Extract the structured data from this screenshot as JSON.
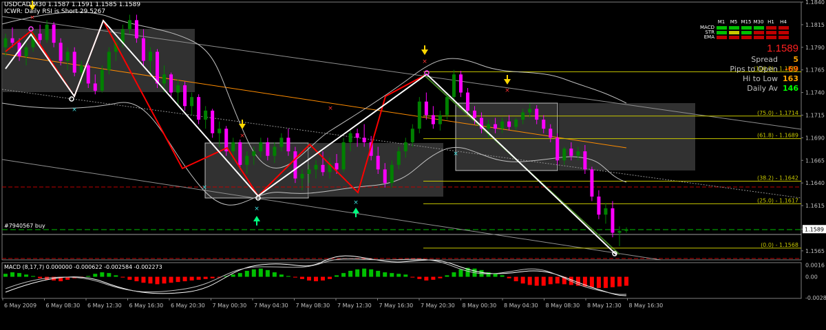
{
  "header": {
    "symbol_line": "USDCAD,M30  1.1587 1.1591 1.1585 1.1589",
    "indicator_line": "ICWR: Daily RSI is Short 29.5267"
  },
  "panel": {
    "timeframes": [
      "M1",
      "M5",
      "M15",
      "M30",
      "H1",
      "H4"
    ],
    "rows": [
      {
        "label": "MACD",
        "colors": [
          "#00c000",
          "#00c000",
          "#00c000",
          "#00c000",
          "#c00000",
          "#c00000"
        ]
      },
      {
        "label": "STR",
        "colors": [
          "#00c000",
          "#c8c800",
          "#00c000",
          "#c00000",
          "#c00000",
          "#c00000"
        ]
      },
      {
        "label": "EMA",
        "colors": [
          "#c00000",
          "#c00000",
          "#c00000",
          "#c00000",
          "#c00000",
          "#c00000"
        ]
      }
    ],
    "price": "1.1589",
    "price_color": "#ff2020",
    "stats": [
      {
        "label": "Spread",
        "value": "5",
        "color": "#ffa500"
      },
      {
        "label": "Pips to Open",
        "value": "-69",
        "color": "#ff6600"
      },
      {
        "label": "Hi to Low",
        "value": "163",
        "color": "#ffa500"
      },
      {
        "label": "Daily Av",
        "value": "146",
        "color": "#00ff00"
      }
    ]
  },
  "order_label": "#7940567 buy",
  "colors": {
    "bull": "#008000",
    "bear": "#ff00ff",
    "fib": "#c8c800",
    "zigzag_red": "#ff0000",
    "zigzag_white": "#ffffff",
    "macd_pos": "#00c000",
    "macd_neg": "#ff0000"
  },
  "chart_data": [
    {
      "type": "candlestick",
      "symbol": "USDCAD",
      "timeframe": "M30",
      "ylim": [
        1.1555,
        1.184
      ],
      "y_ticks": [
        "1.1840",
        "1.1815",
        "1.1790",
        "1.1765",
        "1.1740",
        "1.1715",
        "1.1690",
        "1.1665",
        "1.1640",
        "1.1615",
        "1.1589",
        "1.1565"
      ],
      "x_ticks": [
        "6 May 2009",
        "6 May 08:30",
        "6 May 12:30",
        "6 May 16:30",
        "6 May 20:30",
        "7 May 00:30",
        "7 May 04:30",
        "7 May 08:30",
        "7 May 12:30",
        "7 May 16:30",
        "7 May 20:30",
        "8 May 00:30",
        "8 May 04:30",
        "8 May 08:30",
        "8 May 12:30",
        "8 May 16:30"
      ],
      "last_price": "1.1589",
      "fib_levels": [
        {
          "label": "(100.0) - 1.1763",
          "value": 1.1763
        },
        {
          "label": "(75.0) - 1.1714",
          "value": 1.1714
        },
        {
          "label": "(61.8) - 1.1689",
          "value": 1.1689
        },
        {
          "label": "(38.2) - 1.1642",
          "value": 1.1642
        },
        {
          "label": "(25.0) - 1.1617",
          "value": 1.1617
        },
        {
          "label": "(0.0) - 1.1568",
          "value": 1.1568
        }
      ],
      "candles_ohlc": [
        [
          1.179,
          1.1805,
          1.178,
          1.18
        ],
        [
          1.18,
          1.1812,
          1.179,
          1.1795
        ],
        [
          1.1795,
          1.18,
          1.1775,
          1.178
        ],
        [
          1.178,
          1.1795,
          1.177,
          1.179
        ],
        [
          1.179,
          1.1808,
          1.1785,
          1.1805
        ],
        [
          1.1805,
          1.1815,
          1.179,
          1.1798
        ],
        [
          1.1798,
          1.182,
          1.1795,
          1.1815
        ],
        [
          1.1815,
          1.1818,
          1.179,
          1.1795
        ],
        [
          1.1795,
          1.18,
          1.177,
          1.1775
        ],
        [
          1.1775,
          1.179,
          1.1765,
          1.1785
        ],
        [
          1.1785,
          1.179,
          1.1758,
          1.1762
        ],
        [
          1.1762,
          1.1775,
          1.175,
          1.177
        ],
        [
          1.177,
          1.1772,
          1.1745,
          1.175
        ],
        [
          1.175,
          1.176,
          1.1738,
          1.1742
        ],
        [
          1.1742,
          1.177,
          1.174,
          1.1765
        ],
        [
          1.1765,
          1.179,
          1.176,
          1.1785
        ],
        [
          1.1785,
          1.18,
          1.1775,
          1.1795
        ],
        [
          1.1795,
          1.1815,
          1.179,
          1.181
        ],
        [
          1.181,
          1.1826,
          1.1805,
          1.182
        ],
        [
          1.182,
          1.1826,
          1.1795,
          1.18
        ],
        [
          1.18,
          1.181,
          1.177,
          1.1775
        ],
        [
          1.1775,
          1.179,
          1.176,
          1.1785
        ],
        [
          1.1785,
          1.1788,
          1.1745,
          1.175
        ],
        [
          1.175,
          1.177,
          1.174,
          1.176
        ],
        [
          1.176,
          1.1762,
          1.1735,
          1.174
        ],
        [
          1.174,
          1.1755,
          1.1725,
          1.1748
        ],
        [
          1.1748,
          1.1752,
          1.172,
          1.1725
        ],
        [
          1.1725,
          1.174,
          1.1715,
          1.1735
        ],
        [
          1.1735,
          1.1738,
          1.1705,
          1.171
        ],
        [
          1.171,
          1.1725,
          1.17,
          1.172
        ],
        [
          1.172,
          1.1722,
          1.169,
          1.1695
        ],
        [
          1.1695,
          1.1708,
          1.168,
          1.17
        ],
        [
          1.17,
          1.1703,
          1.167,
          1.1675
        ],
        [
          1.1675,
          1.169,
          1.1665,
          1.1685
        ],
        [
          1.1685,
          1.1688,
          1.1655,
          1.166
        ],
        [
          1.166,
          1.1675,
          1.165,
          1.167
        ],
        [
          1.167,
          1.168,
          1.166,
          1.1675
        ],
        [
          1.1675,
          1.169,
          1.1668,
          1.1685
        ],
        [
          1.1685,
          1.169,
          1.1665,
          1.167
        ],
        [
          1.167,
          1.1685,
          1.1662,
          1.168
        ],
        [
          1.168,
          1.1695,
          1.1675,
          1.169
        ],
        [
          1.169,
          1.17,
          1.167,
          1.1675
        ],
        [
          1.1675,
          1.168,
          1.164,
          1.1645
        ],
        [
          1.1645,
          1.1655,
          1.1632,
          1.165
        ],
        [
          1.165,
          1.166,
          1.164,
          1.1655
        ],
        [
          1.1655,
          1.1665,
          1.1645,
          1.166
        ],
        [
          1.166,
          1.1675,
          1.1648,
          1.1652
        ],
        [
          1.1652,
          1.1668,
          1.1645,
          1.1662
        ],
        [
          1.1662,
          1.1672,
          1.165,
          1.1655
        ],
        [
          1.1655,
          1.169,
          1.1652,
          1.1685
        ],
        [
          1.1685,
          1.1698,
          1.1675,
          1.1695
        ],
        [
          1.1695,
          1.17,
          1.168,
          1.169
        ],
        [
          1.169,
          1.1705,
          1.168,
          1.1685
        ],
        [
          1.1685,
          1.1692,
          1.1665,
          1.167
        ],
        [
          1.167,
          1.168,
          1.165,
          1.1655
        ],
        [
          1.1655,
          1.1662,
          1.1635,
          1.164
        ],
        [
          1.164,
          1.1665,
          1.1635,
          1.166
        ],
        [
          1.166,
          1.168,
          1.1655,
          1.1675
        ],
        [
          1.1675,
          1.169,
          1.1668,
          1.1685
        ],
        [
          1.1685,
          1.1705,
          1.168,
          1.17
        ],
        [
          1.17,
          1.1735,
          1.1695,
          1.173
        ],
        [
          1.173,
          1.174,
          1.171,
          1.1715
        ],
        [
          1.1715,
          1.1725,
          1.17,
          1.1705
        ],
        [
          1.1705,
          1.172,
          1.1698,
          1.1715
        ],
        [
          1.1715,
          1.174,
          1.171,
          1.1735
        ],
        [
          1.1735,
          1.1765,
          1.173,
          1.176
        ],
        [
          1.176,
          1.1764,
          1.1735,
          1.174
        ],
        [
          1.174,
          1.1745,
          1.1715,
          1.172
        ],
        [
          1.172,
          1.1725,
          1.1705,
          1.1712
        ],
        [
          1.1712,
          1.1718,
          1.1695,
          1.17
        ],
        [
          1.17,
          1.171,
          1.169,
          1.1705
        ],
        [
          1.1705,
          1.1712,
          1.1695,
          1.17
        ],
        [
          1.17,
          1.1712,
          1.1695,
          1.1708
        ],
        [
          1.1708,
          1.1715,
          1.1698,
          1.1702
        ],
        [
          1.1702,
          1.1712,
          1.1698,
          1.171
        ],
        [
          1.171,
          1.1722,
          1.1705,
          1.1718
        ],
        [
          1.1718,
          1.1728,
          1.1712,
          1.1722
        ],
        [
          1.1722,
          1.1726,
          1.1705,
          1.171
        ],
        [
          1.171,
          1.1715,
          1.1695,
          1.17
        ],
        [
          1.17,
          1.1705,
          1.1685,
          1.169
        ],
        [
          1.169,
          1.1695,
          1.166,
          1.1665
        ],
        [
          1.1665,
          1.168,
          1.166,
          1.1678
        ],
        [
          1.1678,
          1.1685,
          1.1665,
          1.167
        ],
        [
          1.167,
          1.168,
          1.1665,
          1.1675
        ],
        [
          1.1675,
          1.1682,
          1.165,
          1.1655
        ],
        [
          1.1655,
          1.1658,
          1.162,
          1.1625
        ],
        [
          1.1625,
          1.1632,
          1.16,
          1.1605
        ],
        [
          1.1605,
          1.1618,
          1.1595,
          1.1612
        ],
        [
          1.1612,
          1.162,
          1.158,
          1.1585
        ],
        [
          1.1585,
          1.1592,
          1.157,
          1.1587
        ],
        [
          1.1587,
          1.1591,
          1.1585,
          1.1589
        ]
      ]
    },
    {
      "type": "bar",
      "title": "MACD (8,17,7) 0.000000 -0.000622 -0.002584 -0.002273",
      "ylim": [
        -0.0029,
        0.0019
      ],
      "y_ticks": [
        "0.0016",
        "0.00",
        "-0.0028"
      ],
      "histogram": [
        0.0004,
        0.0006,
        0.0005,
        0.0003,
        0.0001,
        -0.0002,
        -0.0004,
        -0.0005,
        -0.0006,
        -0.0004,
        -0.0002,
        -0.0001,
        0.0001,
        0.0004,
        0.0006,
        0.0005,
        0.0002,
        -0.0001,
        -0.0004,
        -0.0006,
        -0.0008,
        -0.0009,
        -0.001,
        -0.0009,
        -0.0008,
        -0.0007,
        -0.0006,
        -0.0005,
        -0.0004,
        -0.0003,
        -0.0002,
        -0.0001,
        0.0001,
        0.0003,
        0.0005,
        0.0008,
        0.001,
        0.0011,
        0.0009,
        0.0006,
        0.0003,
        0.0001,
        -0.0001,
        -0.0003,
        -0.0005,
        -0.0006,
        -0.0005,
        -0.0003,
        0.0002,
        0.0005,
        0.0008,
        0.001,
        0.0011,
        0.001,
        0.0008,
        0.0006,
        0.0005,
        0.0004,
        0.0003,
        -0.0001,
        -0.0003,
        -0.0005,
        -0.0004,
        -0.0002,
        0.0002,
        0.0006,
        0.001,
        0.0012,
        0.0011,
        0.0009,
        0.0006,
        0.0004,
        0.0002,
        -0.0002,
        -0.0006,
        -0.0009,
        -0.0011,
        -0.0012,
        -0.0012,
        -0.001,
        -0.0009,
        -0.001,
        -0.0011,
        -0.0012,
        -0.0013,
        -0.0014,
        -0.0015,
        -0.0015,
        -0.0014,
        -0.0013,
        -0.0012
      ]
    }
  ]
}
